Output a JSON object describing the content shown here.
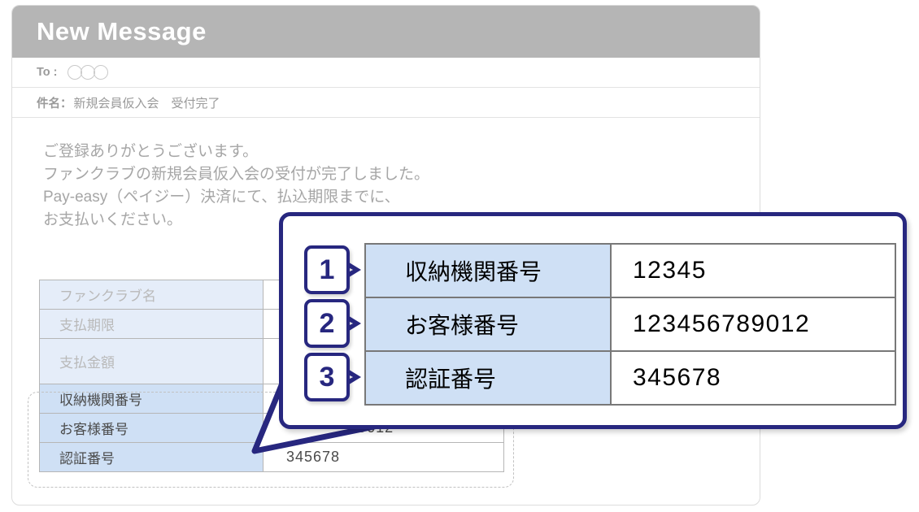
{
  "mail": {
    "header_title": "New Message",
    "to_label": "To :",
    "to_circle_count": 3,
    "subject_label": "件名：",
    "subject_value": "新規会員仮入会　受付完了",
    "body_lines": [
      "ご登録ありがとうございます。",
      "ファンクラブの新規会員仮入会の受付が完了しました。",
      "Pay-easy（ペイジー）決済にて、払込期限までに、",
      "お支払いください。"
    ]
  },
  "background_table": {
    "rows": [
      {
        "key": "ファンクラブ名",
        "value": "",
        "emphasis": false,
        "tall": false
      },
      {
        "key": "支払期限",
        "value": "",
        "emphasis": false,
        "tall": false
      },
      {
        "key": "支払金額",
        "value": "",
        "emphasis": false,
        "tall": true
      },
      {
        "key": "収納機関番号",
        "value": "12345",
        "emphasis": true,
        "tall": false
      },
      {
        "key": "お客様番号",
        "value": "123456789012",
        "emphasis": true,
        "tall": false
      },
      {
        "key": "認証番号",
        "value": "345678",
        "emphasis": true,
        "tall": false
      }
    ]
  },
  "callout": {
    "rows": [
      {
        "badge": "1",
        "key": "収納機関番号",
        "value": "12345"
      },
      {
        "badge": "2",
        "key": "お客様番号",
        "value": "123456789012"
      },
      {
        "badge": "3",
        "key": "認証番号",
        "value": "345678"
      }
    ]
  },
  "colors": {
    "header_bar": "#b5b5b5",
    "callout_border": "#27277f",
    "key_cell_light": "#e5edf9",
    "key_cell_strong": "#cfe0f5",
    "body_text": "#a6a6a6"
  }
}
